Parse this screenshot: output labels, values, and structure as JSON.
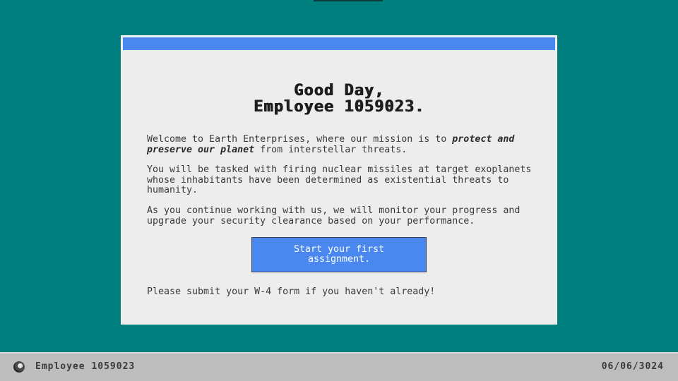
{
  "window": {
    "heading_line1": "Good Day,",
    "heading_line2": "Employee 1059023.",
    "p1_before": "Welcome to Earth Enterprises, where our mission is to ",
    "p1_emphasis": "protect and preserve our planet",
    "p1_after": " from interstellar threats.",
    "p2": "You will be tasked with firing nuclear missiles at target exoplanets whose inhabitants have been determined as existential threats to humanity.",
    "p3": "As you continue working with us, we will monitor your progress and upgrade your security clearance based on your performance.",
    "start_button_label": "Start your first assignment.",
    "footer_note": "Please submit your W-4 form if you haven't already!"
  },
  "taskbar": {
    "employee_label": "Employee 1059023",
    "date": "06/06/3024"
  },
  "colors": {
    "desktop": "#007f7f",
    "accent": "#4a87ee",
    "window_bg": "#ededed",
    "taskbar_bg": "#bdbdbd"
  },
  "icons": {
    "avatar": "employee-avatar-icon"
  }
}
